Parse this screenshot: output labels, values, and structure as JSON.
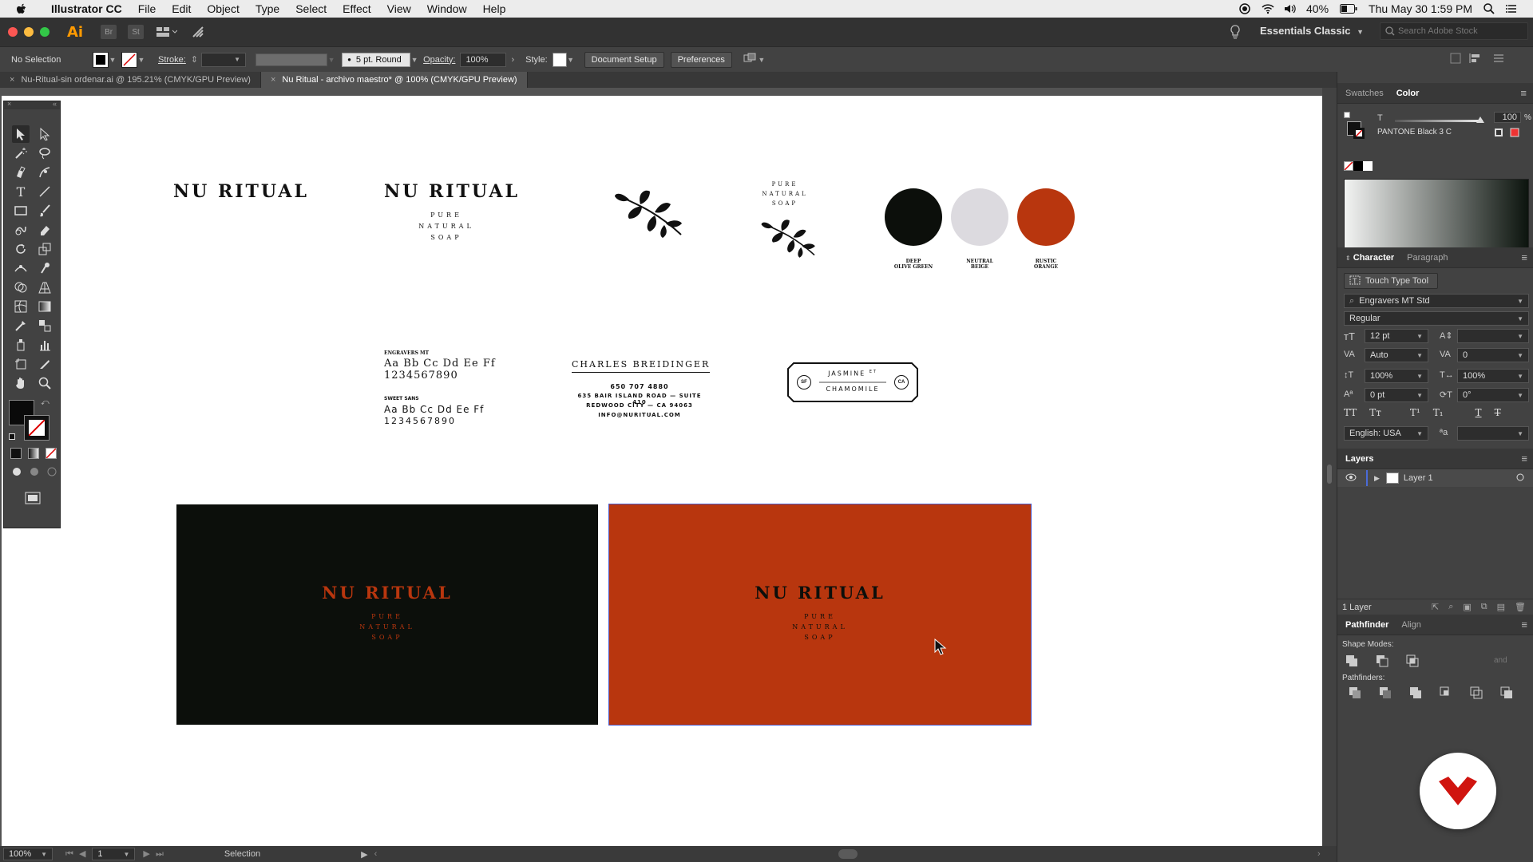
{
  "menubar": {
    "app": "Illustrator CC",
    "items": [
      "File",
      "Edit",
      "Object",
      "Type",
      "Select",
      "Effect",
      "View",
      "Window",
      "Help"
    ],
    "battery": "40%",
    "clock": "Thu May 30  1:59 PM"
  },
  "appbar": {
    "logo": "Ai",
    "br_label": "Br",
    "st_label": "St",
    "workspace": "Essentials Classic",
    "stock_placeholder": "Search Adobe Stock"
  },
  "controlbar": {
    "selection": "No Selection",
    "stroke_label": "Stroke:",
    "brush": "5 pt. Round",
    "opacity_label": "Opacity:",
    "opacity_value": "100%",
    "style_label": "Style:",
    "doc_setup": "Document Setup",
    "preferences": "Preferences"
  },
  "tabs": [
    {
      "label": "Nu-Ritual-sin ordenar.ai @ 195.21% (CMYK/GPU Preview)",
      "active": false
    },
    {
      "label": "Nu Ritual - archivo maestro* @ 100% (CMYK/GPU Preview)",
      "active": true
    }
  ],
  "artboard": {
    "logo_text": "NU RITUAL",
    "tagline": [
      "PURE",
      "NATURAL",
      "SOAP"
    ],
    "colors": [
      {
        "name_lines": [
          "DEEP",
          "OLIVE GREEN"
        ],
        "hex": "#0c0f0b"
      },
      {
        "name_lines": [
          "NEUTRAL",
          "BEIGE"
        ],
        "hex": "#dcdadf"
      },
      {
        "name_lines": [
          "RUSTIC",
          "ORANGE"
        ],
        "hex": "#b8360e"
      }
    ],
    "type1_name": "ENGRAVERS MT",
    "type1_line1": "Aa Bb Cc Dd Ee Ff",
    "type1_line2": "1234567890",
    "type2_name": "SWEET SANS",
    "type2_line1": "Aa Bb Cc Dd Ee Ff",
    "type2_line2": "1234567890",
    "contact_name": "CHARLES BREIDINGER",
    "contact_phone": "650 707 4880",
    "contact_addr": "635 BAIR ISLAND ROAD — SUITE 410",
    "contact_city": "REDWOOD CITY — CA 94063",
    "contact_email": "INFO@NURITUAL.COM",
    "label_top": "JASMINE",
    "label_top_sup": "ET",
    "label_bottom": "CHAMOMILE",
    "label_left": "SF",
    "label_right": "CA"
  },
  "statusbar": {
    "zoom": "100%",
    "page": "1",
    "tool": "Selection"
  },
  "panels": {
    "swatches_tab": "Swatches",
    "color_tab": "Color",
    "tint_label": "T",
    "tint_value": "100",
    "tint_unit": "%",
    "pantone": "PANTONE Black 3 C",
    "character_tab": "Character",
    "paragraph_tab": "Paragraph",
    "touch_type": "Touch Type Tool",
    "font_family": "Engravers MT Std",
    "font_style": "Regular",
    "font_size": "12 pt",
    "leading": "Auto",
    "kerning": "",
    "tracking": "0",
    "vscale": "100%",
    "hscale": "100%",
    "baseline": "0 pt",
    "rotation": "0°",
    "language": "English: USA",
    "layers_tab": "Layers",
    "layer_name": "Layer 1",
    "layer_count": "1 Layer",
    "pathfinder_tab": "Pathfinder",
    "align_tab": "Align",
    "shape_modes": "Shape Modes:",
    "pathfinders": "Pathfinders:",
    "expand": "and"
  },
  "colors": {
    "rustic_orange": "#b8360e",
    "deep_olive": "#0c0f0b",
    "video_badge": "#d0140f"
  }
}
